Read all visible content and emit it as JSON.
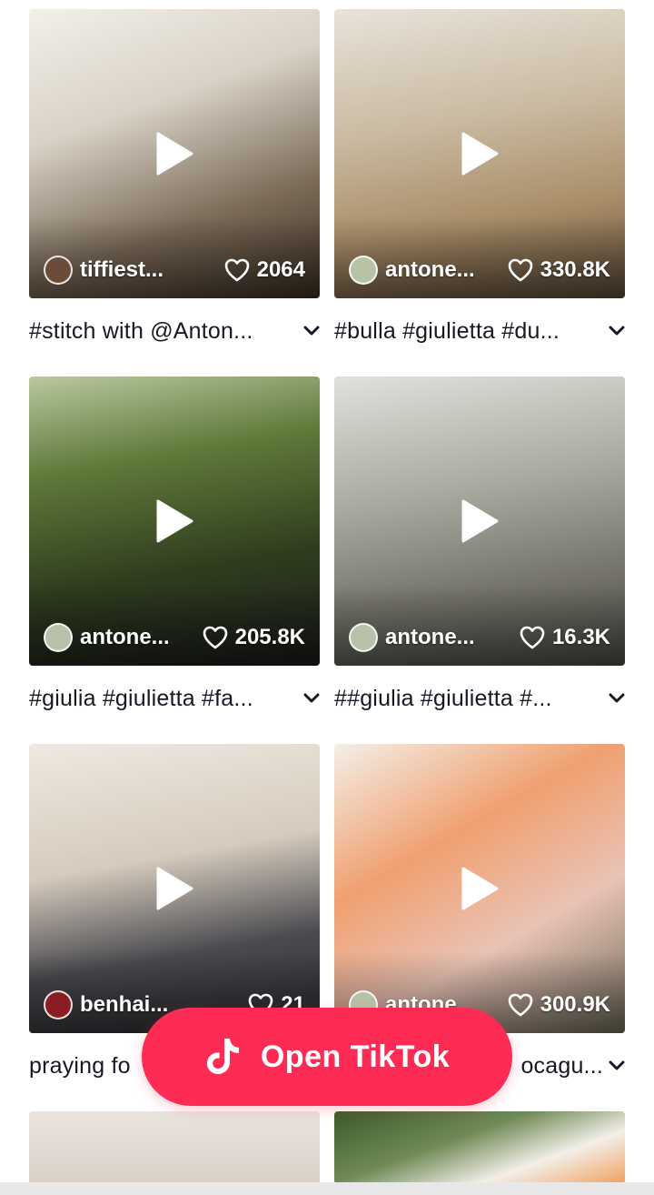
{
  "videos": [
    {
      "author": "tiffiest...",
      "likes": "2064",
      "caption": "#stitch with @Anton...",
      "bg": "linear-gradient(160deg,#f2f0ea 0%,#d9d2c6 35%,#7a6a57 70%,#3c2f24 100%)"
    },
    {
      "author": "antone...",
      "likes": "330.8K",
      "caption": "#bulla #giulietta #du...",
      "bg": "linear-gradient(170deg,#e8e3da 0%,#c9b9a0 40%,#a98d68 70%,#5a4a38 100%)"
    },
    {
      "author": "antone...",
      "likes": "205.8K",
      "caption": "#giulia #giulietta #fa...",
      "bg": "linear-gradient(170deg,#b9c9a0 0%,#5f7a3a 30%,#2f3d1e 65%,#1a1a1a 100%)"
    },
    {
      "author": "antone...",
      "likes": "16.3K",
      "caption": "##giulia #giulietta #...",
      "bg": "linear-gradient(170deg,#dfe2dc 0%,#a8aa9f 40%,#77766d 70%,#4a4a44 100%)"
    },
    {
      "author": "benhai...",
      "likes": "21",
      "caption": "praying fo",
      "bg": "linear-gradient(170deg,#efe9e1 0%,#d6cbbd 40%,#4a4a4f 70%,#2b2b30 100%)"
    },
    {
      "author": "antone",
      "likes": "300.9K",
      "caption": "ocagu...",
      "bg": "linear-gradient(150deg,#f4efe8 0%,#f0a070 35%,#e9c3b5 65%,#6d6a5a 100%)"
    },
    {
      "bg": "linear-gradient(180deg,#e9e4de 0%,#d9cfc6 100%)"
    },
    {
      "bg": "linear-gradient(160deg,#3b5a2a 0%,#6f8a56 40%,#f3efe9 70%,#f0a060 100%)"
    }
  ],
  "open_button": {
    "label": "Open TikTok"
  },
  "colors": {
    "accent": "#fe2c55",
    "text": "#161823"
  }
}
